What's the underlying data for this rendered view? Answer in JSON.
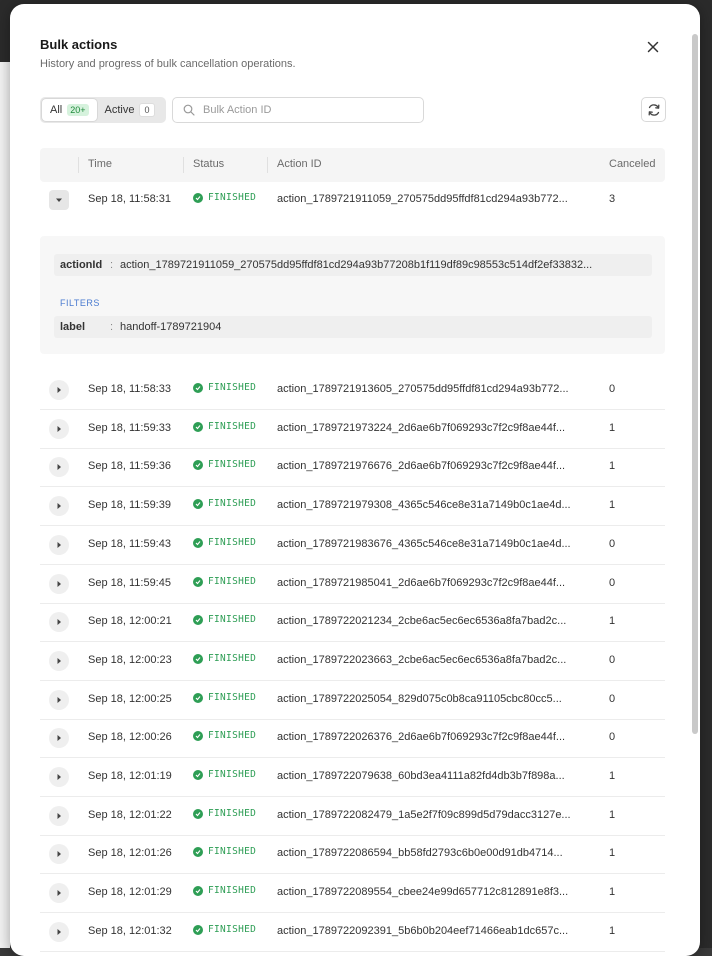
{
  "modal": {
    "title": "Bulk actions",
    "subtitle": "History and progress of bulk cancellation operations."
  },
  "tabs": [
    {
      "label": "All",
      "count": "20+",
      "active": true
    },
    {
      "label": "Active",
      "count": "0",
      "active": false
    }
  ],
  "search": {
    "placeholder": "Bulk Action ID",
    "value": ""
  },
  "table": {
    "headers": {
      "time": "Time",
      "status": "Status",
      "action_id": "Action ID",
      "canceled": "Canceled"
    },
    "expanded_row": {
      "time": "Sep 18, 11:58:31",
      "status": "FINISHED",
      "action_id": "action_1789721911059_270575dd95ffdf81cd294a93b772...",
      "canceled": "3",
      "detail": {
        "action_id_key": "actionId",
        "action_id_value": "action_1789721911059_270575dd95ffdf81cd294a93b77208b1f119df89c98553c514df2ef33832...",
        "filters_label": "FILTERS",
        "label_key": "label",
        "label_value": "handoff-1789721904"
      }
    },
    "rows": [
      {
        "time": "Sep 18, 11:58:33",
        "status": "FINISHED",
        "action_id": "action_1789721913605_270575dd95ffdf81cd294a93b772...",
        "canceled": "0"
      },
      {
        "time": "Sep 18, 11:59:33",
        "status": "FINISHED",
        "action_id": "action_1789721973224_2d6ae6b7f069293c7f2c9f8ae44f...",
        "canceled": "1"
      },
      {
        "time": "Sep 18, 11:59:36",
        "status": "FINISHED",
        "action_id": "action_1789721976676_2d6ae6b7f069293c7f2c9f8ae44f...",
        "canceled": "1"
      },
      {
        "time": "Sep 18, 11:59:39",
        "status": "FINISHED",
        "action_id": "action_1789721979308_4365c546ce8e31a7149b0c1ae4d...",
        "canceled": "1"
      },
      {
        "time": "Sep 18, 11:59:43",
        "status": "FINISHED",
        "action_id": "action_1789721983676_4365c546ce8e31a7149b0c1ae4d...",
        "canceled": "0"
      },
      {
        "time": "Sep 18, 11:59:45",
        "status": "FINISHED",
        "action_id": "action_1789721985041_2d6ae6b7f069293c7f2c9f8ae44f...",
        "canceled": "0"
      },
      {
        "time": "Sep 18, 12:00:21",
        "status": "FINISHED",
        "action_id": "action_1789722021234_2cbe6ac5ec6ec6536a8fa7bad2c...",
        "canceled": "1"
      },
      {
        "time": "Sep 18, 12:00:23",
        "status": "FINISHED",
        "action_id": "action_1789722023663_2cbe6ac5ec6ec6536a8fa7bad2c...",
        "canceled": "0"
      },
      {
        "time": "Sep 18, 12:00:25",
        "status": "FINISHED",
        "action_id": "action_1789722025054_829d075c0b8ca91105cbc80cc5...",
        "canceled": "0"
      },
      {
        "time": "Sep 18, 12:00:26",
        "status": "FINISHED",
        "action_id": "action_1789722026376_2d6ae6b7f069293c7f2c9f8ae44f...",
        "canceled": "0"
      },
      {
        "time": "Sep 18, 12:01:19",
        "status": "FINISHED",
        "action_id": "action_1789722079638_60bd3ea4111a82fd4db3b7f898a...",
        "canceled": "1"
      },
      {
        "time": "Sep 18, 12:01:22",
        "status": "FINISHED",
        "action_id": "action_1789722082479_1a5e2f7f09c899d5d79dacc3127e...",
        "canceled": "1"
      },
      {
        "time": "Sep 18, 12:01:26",
        "status": "FINISHED",
        "action_id": "action_1789722086594_bb58fd2793c6b0e00d91db4714...",
        "canceled": "1"
      },
      {
        "time": "Sep 18, 12:01:29",
        "status": "FINISHED",
        "action_id": "action_1789722089554_cbee24e99d657712c812891e8f3...",
        "canceled": "1"
      },
      {
        "time": "Sep 18, 12:01:32",
        "status": "FINISHED",
        "action_id": "action_1789722092391_5b6b0b204eef71466eab1dc657c...",
        "canceled": "1"
      }
    ]
  },
  "colors": {
    "status_green": "#2e9e55",
    "badge_green_bg": "#d6f2dd",
    "filters_blue": "#4a7bd0"
  },
  "icons": {
    "close": "close-icon",
    "search": "search-icon",
    "refresh": "refresh-icon",
    "expand": "chevron-right-icon",
    "collapse": "chevron-down-icon",
    "status": "check-circle-icon"
  }
}
